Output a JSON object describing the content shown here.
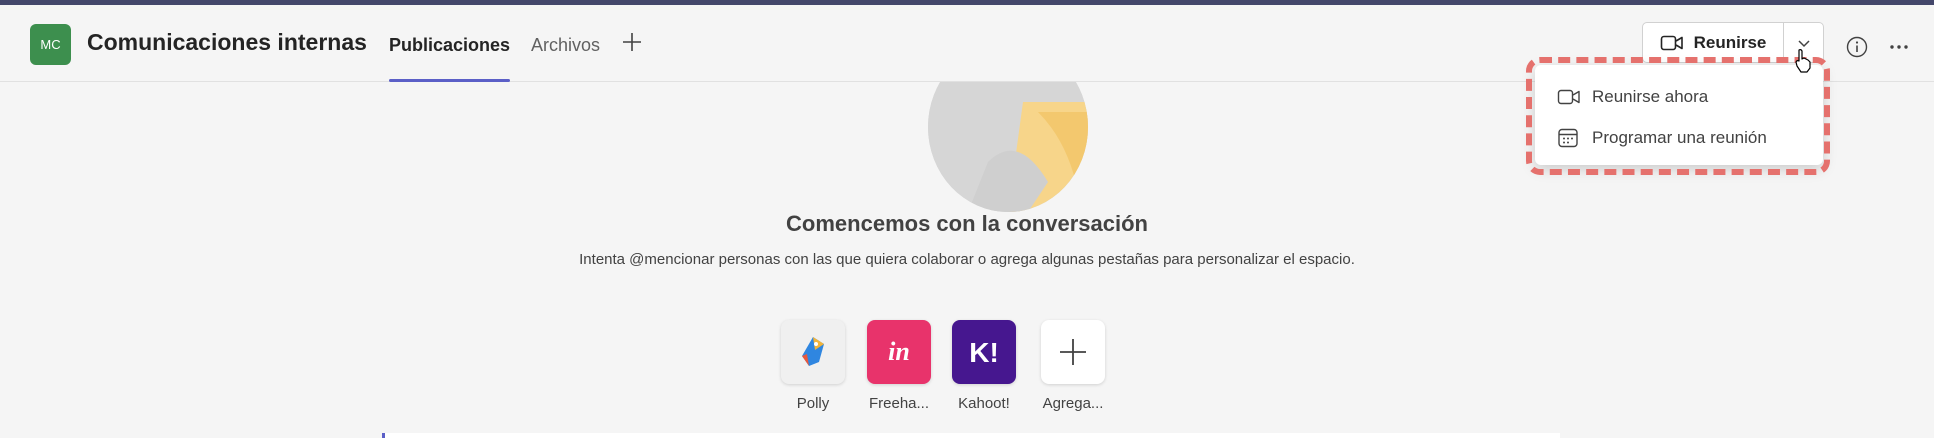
{
  "header": {
    "avatar_initials": "MC",
    "title": "Comunicaciones internas",
    "tabs": [
      {
        "label": "Publicaciones",
        "active": true
      },
      {
        "label": "Archivos",
        "active": false
      }
    ],
    "meet_button_label": "Reunirse"
  },
  "meet_menu": {
    "items": [
      {
        "label": "Reunirse ahora",
        "icon": "video-camera-icon"
      },
      {
        "label": "Programar una reunión",
        "icon": "calendar-icon"
      }
    ]
  },
  "empty_state": {
    "title": "Comencemos con la conversación",
    "subtitle": "Intenta @mencionar personas con las que quiera colaborar o agrega algunas pestañas para personalizar el espacio."
  },
  "apps": [
    {
      "label": "Polly",
      "icon": "polly-app-icon",
      "color": "#f0f0f0"
    },
    {
      "label": "Freeha...",
      "icon": "invision-freehand-app-icon",
      "color": "#e8336b"
    },
    {
      "label": "Kahoot!",
      "icon": "kahoot-app-icon",
      "color": "#46178f"
    },
    {
      "label": "Agrega...",
      "icon": "add-app-icon",
      "color": "#ffffff"
    }
  ],
  "colors": {
    "accent": "#5b5fc7",
    "team_avatar": "#3d8f4e",
    "highlight": "#e5716d",
    "top_bar": "#44476b"
  }
}
